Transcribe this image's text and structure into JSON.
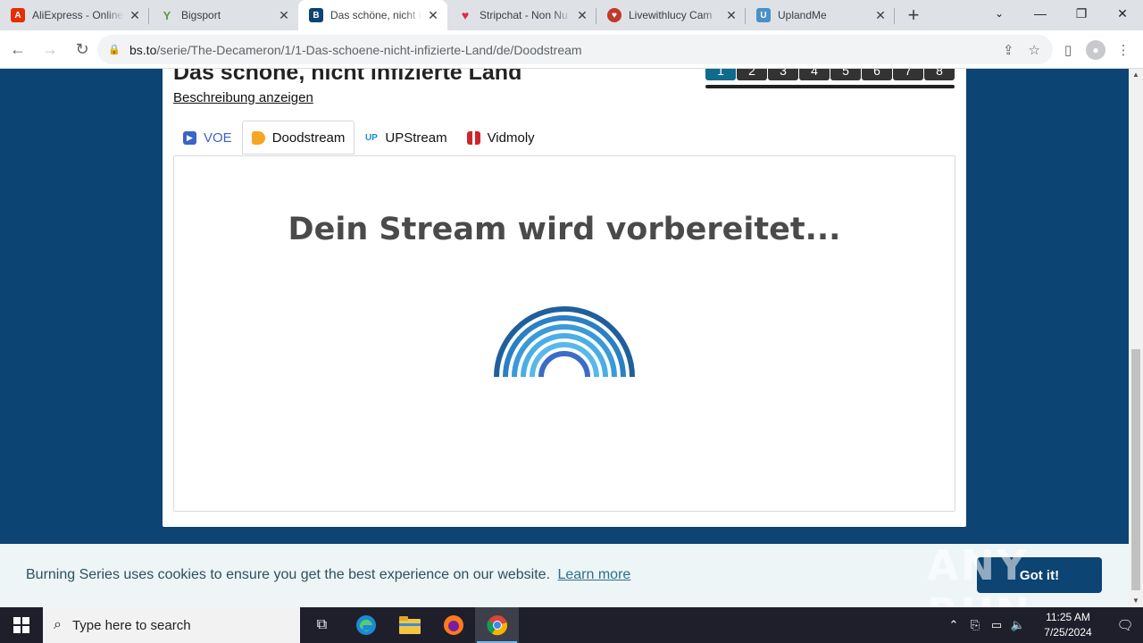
{
  "browser": {
    "tabs": [
      {
        "title": "AliExpress - Online",
        "favicon": "aliexpress-icon",
        "color": "#e62e04"
      },
      {
        "title": "Bigsport",
        "favicon": "bigsport-icon",
        "color": "#5a9e3c"
      },
      {
        "title": "Das schöne, nicht i",
        "favicon": "bs-icon",
        "color": "#0c4473",
        "active": true
      },
      {
        "title": "Stripchat - Non Nu",
        "favicon": "heart-icon",
        "color": "#e0284a"
      },
      {
        "title": "Livewithlucy Cam",
        "favicon": "chat-icon",
        "color": "#c0392b"
      },
      {
        "title": "UplandMe",
        "favicon": "upland-icon",
        "color": "#4a90c8"
      }
    ],
    "url_host": "bs.to",
    "url_path": "/serie/The-Decameron/1/1-Das-schoene-nicht-infizierte-Land/de/Doodstream"
  },
  "page": {
    "episode_title": "Das schöne, nicht infizierte Land",
    "description_link": "Beschreibung anzeigen",
    "pages": [
      "1",
      "2",
      "3",
      "4",
      "5",
      "6",
      "7",
      "8"
    ],
    "hosters": [
      {
        "label": "VOE",
        "icon": "voe-icon",
        "color": "#3d63c9"
      },
      {
        "label": "Doodstream",
        "icon": "doodstream-icon",
        "color": "#f5a623",
        "active": true
      },
      {
        "label": "UPStream",
        "icon": "upstream-icon",
        "color": "#1a8fc9"
      },
      {
        "label": "Vidmoly",
        "icon": "vidmoly-icon",
        "color": "#d0242b"
      }
    ],
    "player_message": "Dein Stream wird vorbereitet..."
  },
  "cookie": {
    "text": "Burning Series uses cookies to ensure you get the best experience on our website.",
    "learn_more": "Learn more",
    "button": "Got it!"
  },
  "watermark": "ANY RUN",
  "taskbar": {
    "search_placeholder": "Type here to search",
    "time": "11:25 AM",
    "date": "7/25/2024"
  }
}
